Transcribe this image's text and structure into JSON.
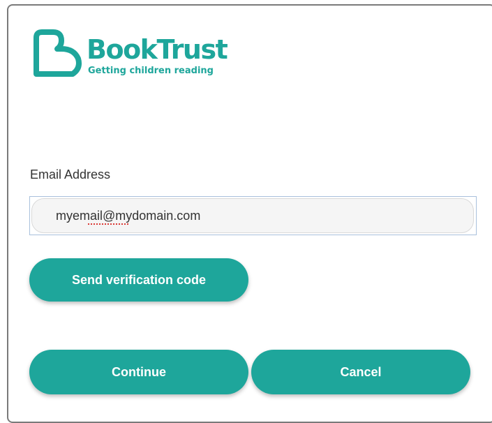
{
  "brand": {
    "name": "BookTrust",
    "tagline": "Getting children reading",
    "color": "#1ea69b",
    "logo_icon": "heart-b-icon"
  },
  "form": {
    "email_label": "Email Address",
    "email_value": "myemail@mydomain.com",
    "send_code_label": "Send verification code",
    "continue_label": "Continue",
    "cancel_label": "Cancel"
  }
}
